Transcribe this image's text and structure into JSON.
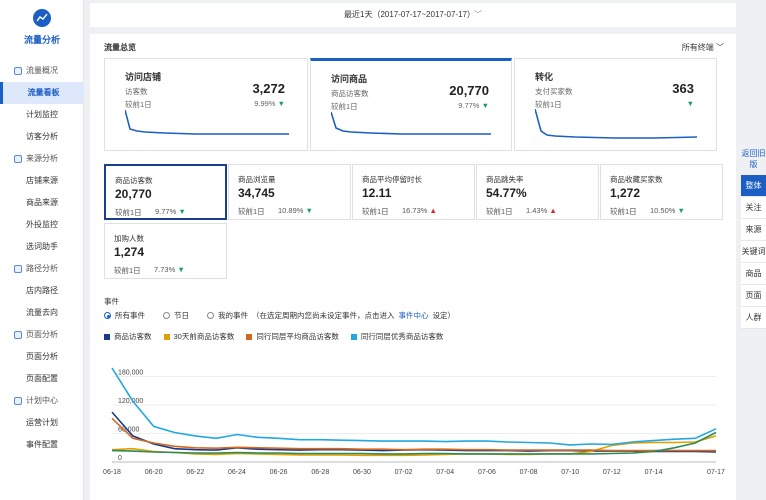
{
  "sidebar": {
    "app_title": "流量分析",
    "groups": [
      {
        "label": "流量概况",
        "items": [
          {
            "label": "流量看板",
            "active": true
          },
          {
            "label": "计划监控"
          },
          {
            "label": "访客分析"
          }
        ]
      },
      {
        "label": "来源分析",
        "items": [
          {
            "label": "店铺来源"
          },
          {
            "label": "商品来源"
          },
          {
            "label": "外投监控"
          },
          {
            "label": "选词助手"
          }
        ]
      },
      {
        "label": "路径分析",
        "items": [
          {
            "label": "店内路径"
          },
          {
            "label": "流量去向"
          }
        ]
      },
      {
        "label": "页面分析",
        "items": [
          {
            "label": "页面分析"
          },
          {
            "label": "页面配置"
          }
        ]
      },
      {
        "label": "计划中心",
        "items": [
          {
            "label": "运营计划"
          },
          {
            "label": "事件配置"
          }
        ]
      }
    ]
  },
  "datebar": {
    "label": "最近1天（2017-07-17~2017-07-17）",
    "chevron": "﹀"
  },
  "main": {
    "title": "流量总览",
    "terminal": "所有终端",
    "terminal_chevron": "﹀"
  },
  "rightnav": {
    "back": "返回旧版",
    "items": [
      {
        "label": "整体",
        "active": true
      },
      {
        "label": "关注"
      },
      {
        "label": "来源"
      },
      {
        "label": "关键词"
      },
      {
        "label": "商品"
      },
      {
        "label": "页面"
      },
      {
        "label": "人群"
      }
    ]
  },
  "bigcards": [
    {
      "title": "访问店铺",
      "label": "访客数",
      "value": "3,272",
      "compare": "较前1日",
      "pct": "9.99%",
      "trend": "down"
    },
    {
      "title": "访问商品",
      "label": "商品访客数",
      "value": "20,770",
      "compare": "较前1日",
      "pct": "9.77%",
      "trend": "down",
      "selected": true
    },
    {
      "title": "转化",
      "label": "支付买家数",
      "value": "363",
      "compare": "较前1日",
      "pct": "",
      "trend": "down"
    }
  ],
  "metrics": [
    {
      "label": "商品访客数",
      "value": "20,770",
      "compare": "较前1日",
      "pct": "9.77%",
      "trend": "down",
      "selected": true
    },
    {
      "label": "商品浏览量",
      "value": "34,745",
      "compare": "较前1日",
      "pct": "10.89%",
      "trend": "down"
    },
    {
      "label": "商品平均停留时长",
      "value": "12.11",
      "compare": "较前1日",
      "pct": "16.73%",
      "trend": "up"
    },
    {
      "label": "商品跳失率",
      "value": "54.77%",
      "compare": "较前1日",
      "pct": "1.43%",
      "trend": "up"
    },
    {
      "label": "商品收藏买家数",
      "value": "1,272",
      "compare": "较前1日",
      "pct": "10.50%",
      "trend": "down"
    },
    {
      "label": "加购人数",
      "value": "1,274",
      "compare": "较前1日",
      "pct": "7.73%",
      "trend": "down"
    }
  ],
  "events": {
    "title": "事件",
    "opt_all": "所有事件",
    "opt_holiday": "节日",
    "opt_mine": "我的事件",
    "note_pre": "（在选定周期内您尚未设定事件，点击进入",
    "link": "事件中心",
    "note_post": "设定）"
  },
  "icons": {
    "arrow_up": "▲",
    "arrow_down": "▼"
  },
  "colors": {
    "accent": "#1c5fc4",
    "up": "#d9262b",
    "down": "#1a9e6a"
  },
  "chart_data": {
    "type": "line",
    "x": [
      "06-18",
      "06-19",
      "06-20",
      "06-21",
      "06-22",
      "06-23",
      "06-24",
      "06-25",
      "06-26",
      "06-27",
      "06-28",
      "06-29",
      "06-30",
      "07-01",
      "07-02",
      "07-03",
      "07-04",
      "07-05",
      "07-06",
      "07-07",
      "07-08",
      "07-09",
      "07-10",
      "07-11",
      "07-12",
      "07-13",
      "07-14",
      "07-15",
      "07-16",
      "07-17"
    ],
    "xticks": [
      "06-18",
      "06-20",
      "06-22",
      "06-24",
      "06-26",
      "06-28",
      "06-30",
      "07-02",
      "07-04",
      "07-06",
      "07-08",
      "07-10",
      "07-12",
      "07-14",
      "07-17"
    ],
    "yticks": [
      "180,000",
      "120,000",
      "60,000",
      "0"
    ],
    "ylim": [
      0,
      240000
    ],
    "series": [
      {
        "name": "商品访客数",
        "color": "#1a3a8f",
        "values": [
          105000,
          55000,
          38000,
          28000,
          26000,
          25000,
          30000,
          27000,
          26000,
          25000,
          26000,
          26000,
          25000,
          24000,
          25000,
          26000,
          25000,
          24000,
          24000,
          24000,
          23000,
          24000,
          24000,
          23000,
          23000,
          23000,
          22000,
          22000,
          22000,
          21000
        ]
      },
      {
        "name": "30天前商品访客数",
        "color": "#e0a000",
        "values": [
          26000,
          28000,
          22000,
          20000,
          17000,
          16000,
          18000,
          17000,
          16000,
          15000,
          15000,
          15000,
          14000,
          14000,
          14000,
          15000,
          16000,
          17000,
          17000,
          16000,
          16000,
          17000,
          17000,
          22000,
          35000,
          40000,
          41000,
          41000,
          42000,
          55000
        ]
      },
      {
        "name": "同行同层平均商品访客数",
        "color": "#d2691e",
        "values": [
          92000,
          50000,
          40000,
          33000,
          30000,
          29000,
          31000,
          30000,
          29000,
          28000,
          28000,
          28000,
          27000,
          27000,
          26000,
          27000,
          27000,
          26000,
          26000,
          25000,
          25000,
          25000,
          25000,
          25000,
          24000,
          24000,
          24000,
          24000,
          24000,
          24000
        ]
      },
      {
        "name": "同行同层优秀商品访客数",
        "color": "#22a7e0",
        "values": [
          198000,
          128000,
          75000,
          62000,
          55000,
          50000,
          58000,
          52000,
          50000,
          47000,
          47000,
          46000,
          45000,
          44000,
          44000,
          44000,
          43000,
          44000,
          44000,
          42000,
          41000,
          40000,
          36000,
          38000,
          37000,
          42000,
          45000,
          48000,
          50000,
          70000
        ]
      },
      {
        "name": "",
        "color": "#2e8b57",
        "values": [
          24000,
          23000,
          21000,
          20000,
          19000,
          19000,
          20000,
          19000,
          19000,
          18000,
          18000,
          18000,
          18000,
          17000,
          17000,
          18000,
          18000,
          17000,
          17000,
          17000,
          17000,
          17000,
          17000,
          17000,
          18000,
          19000,
          22000,
          30000,
          40000,
          62000
        ]
      }
    ]
  }
}
